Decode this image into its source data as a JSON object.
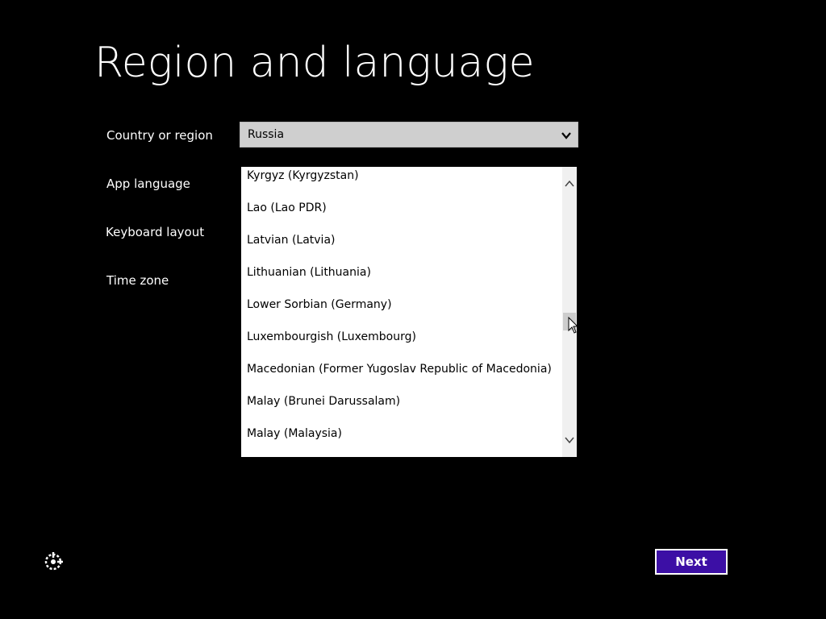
{
  "title": "Region and language",
  "labels": {
    "country_or_region": "Country or region",
    "app_language": "App language",
    "keyboard_layout": "Keyboard layout",
    "time_zone": "Time zone"
  },
  "country_select": {
    "value": "Russia",
    "icon": "chevron-down-icon"
  },
  "language_list": {
    "items": [
      "Kyrgyz (Kyrgyzstan)",
      "Lao (Lao PDR)",
      "Latvian (Latvia)",
      "Lithuanian (Lithuania)",
      "Lower Sorbian (Germany)",
      "Luxembourgish (Luxembourg)",
      "Macedonian (Former Yugoslav Republic of Macedonia)",
      "Malay (Brunei Darussalam)",
      "Malay (Malaysia)"
    ]
  },
  "buttons": {
    "next": "Next"
  },
  "icons": {
    "ease_of_access": "ease-of-access-icon",
    "scroll_up": "chevron-up-icon",
    "scroll_down": "chevron-down-icon",
    "cursor": "mouse-cursor-icon"
  },
  "colors": {
    "background": "#000000",
    "accent": "#3c0fa5",
    "select_background": "#cfcfcf"
  }
}
